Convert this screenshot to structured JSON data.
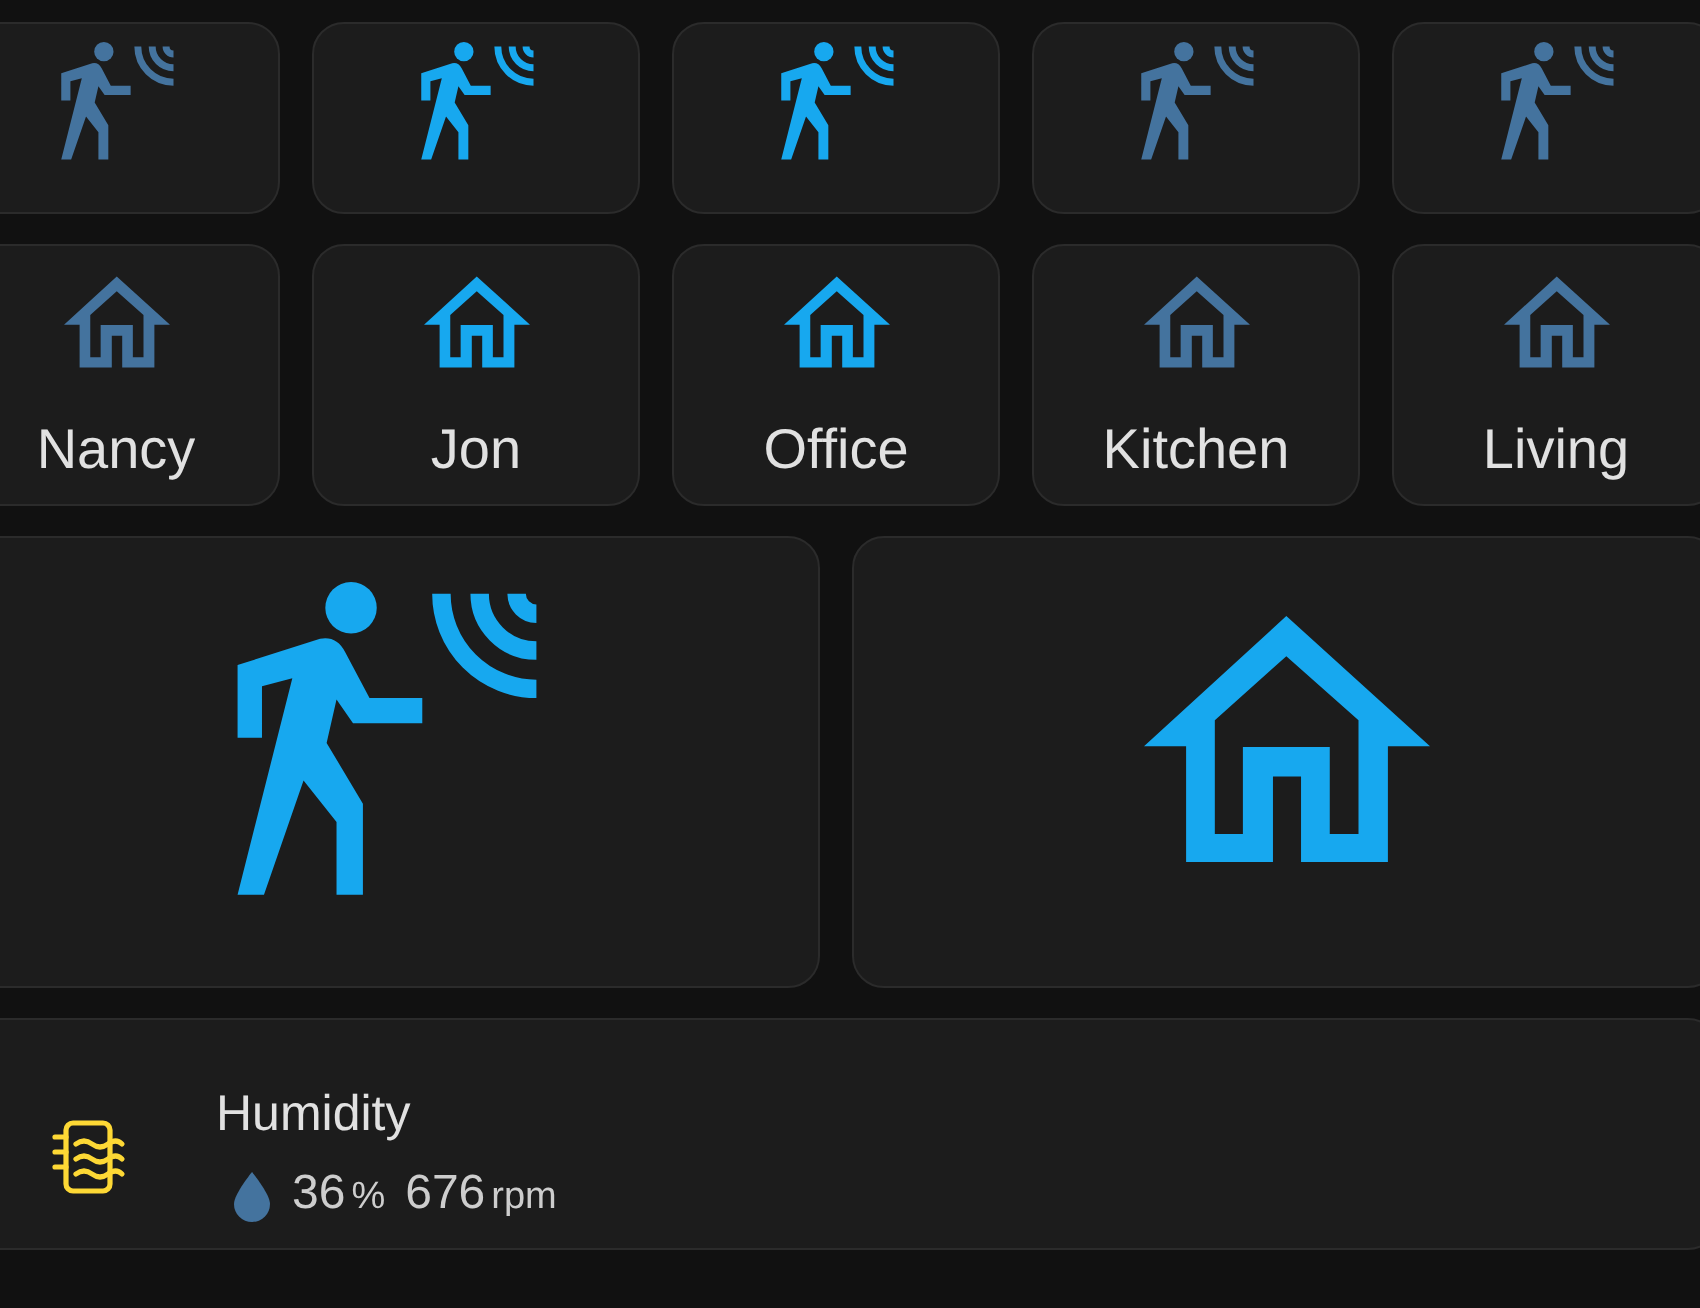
{
  "motion_tiles": [
    {
      "active": false
    },
    {
      "active": true
    },
    {
      "active": true
    },
    {
      "active": false
    },
    {
      "active": false
    }
  ],
  "presence_tiles": [
    {
      "name": "Nancy",
      "active": false
    },
    {
      "name": "Jon",
      "active": true
    },
    {
      "name": "Office",
      "active": true
    },
    {
      "name": "Kitchen",
      "active": false
    },
    {
      "name": "Living",
      "active": false
    }
  ],
  "large_tiles": [
    {
      "kind": "motion",
      "active": true
    },
    {
      "kind": "home",
      "active": true
    }
  ],
  "entity_row": {
    "name": "Humidity",
    "readings": [
      {
        "value": "36",
        "unit": "%"
      },
      {
        "value": "676",
        "unit": "rpm"
      }
    ]
  }
}
